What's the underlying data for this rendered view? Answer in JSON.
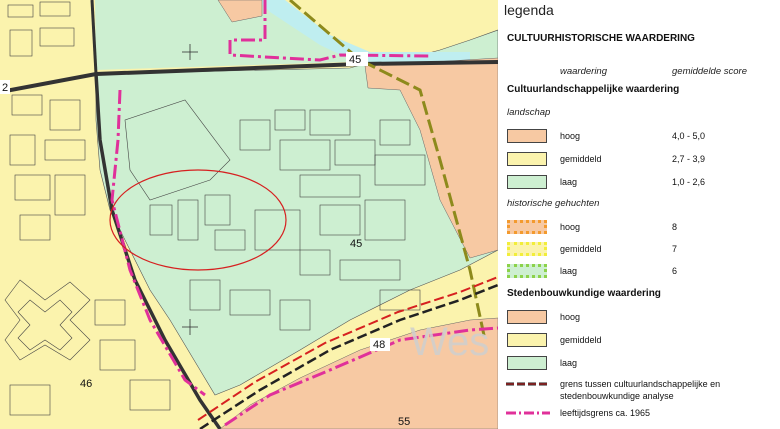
{
  "legend": {
    "title": "legenda",
    "main_heading": "CULTUURHISTORISCHE WAARDERING",
    "col_waardering": "waardering",
    "col_score": "gemiddelde score",
    "cultuur_heading": "Cultuurlandschappelijke waardering",
    "landschap_sub": "landschap",
    "landschap_items": [
      {
        "label": "hoog",
        "score": "4,0 - 5,0",
        "color": "#f7c9a3"
      },
      {
        "label": "gemiddeld",
        "score": "2,7 - 3,9",
        "color": "#fbf3ad"
      },
      {
        "label": "laag",
        "score": "1,0 - 2,6",
        "color": "#cdefd1"
      }
    ],
    "gehuchten_sub": "historische gehuchten",
    "gehuchten_items": [
      {
        "label": "hoog",
        "score": "8",
        "color": "#f39a2e"
      },
      {
        "label": "gemiddeld",
        "score": "7",
        "color": "#f2ee3a"
      },
      {
        "label": "laag",
        "score": "6",
        "color": "#8cd24a"
      }
    ],
    "steden_heading": "Stedenbouwkundige waardering",
    "steden_items": [
      {
        "label": "hoog",
        "color": "#f7c9a3"
      },
      {
        "label": "gemiddeld",
        "color": "#fbf3ad"
      },
      {
        "label": "laag",
        "color": "#cdefd1"
      }
    ],
    "line_items": [
      {
        "label": "grens tussen cultuurlandschappelijke en stedenbouwkundige analyse",
        "line1": "grens tussen cultuurlandschappelijke en",
        "line2": "stedenbouwkundige analyse"
      },
      {
        "label": "leeftijdsgrens ca. 1965"
      }
    ]
  },
  "map": {
    "zone_numbers": [
      "2",
      "45",
      "45",
      "48",
      "46",
      "55"
    ],
    "place_name_fragment": "Wes",
    "colors": {
      "high": "#f7c9a3",
      "medium": "#fbf3ad",
      "low": "#cdefd1",
      "water": "#bfeef0",
      "boundary_pink": "#e0309a",
      "road": "#333333",
      "olive": "#8d8a1c"
    }
  }
}
